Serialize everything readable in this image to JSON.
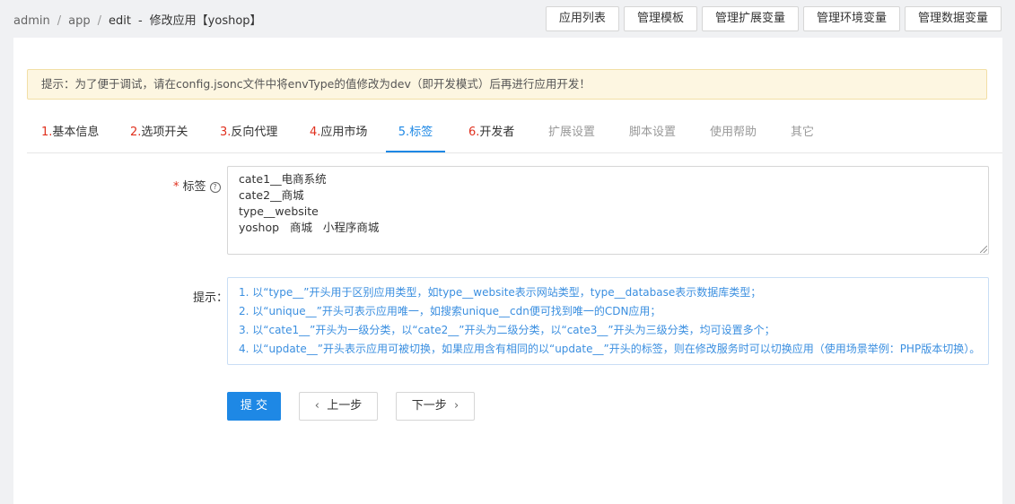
{
  "breadcrumb": {
    "items": [
      "admin",
      "app",
      "edit"
    ],
    "current": "修改应用【yoshop】",
    "dash": "-"
  },
  "top_buttons": [
    "应用列表",
    "管理模板",
    "管理扩展变量",
    "管理环境变量",
    "管理数据变量"
  ],
  "notice": "提示：为了便于调试，请在config.jsonc文件中将envType的值修改为dev（即开发模式）后再进行应用开发！",
  "tabs": [
    {
      "num": "1.",
      "label": "基本信息"
    },
    {
      "num": "2.",
      "label": "选项开关"
    },
    {
      "num": "3.",
      "label": "反向代理"
    },
    {
      "num": "4.",
      "label": "应用市场"
    },
    {
      "num": "5.",
      "label": "标签"
    },
    {
      "num": "6.",
      "label": "开发者"
    },
    {
      "num": "",
      "label": "扩展设置"
    },
    {
      "num": "",
      "label": "脚本设置"
    },
    {
      "num": "",
      "label": "使用帮助"
    },
    {
      "num": "",
      "label": "其它"
    }
  ],
  "active_tab": 4,
  "form": {
    "tags_label": "标签",
    "tags_required_mark": "*",
    "tags_lines": [
      "cate1__电商系统",
      "cate2__商城",
      "type__website",
      "yoshop   商城   小程序商城"
    ],
    "hint_label": "提示：",
    "hint_lines": [
      "1. 以“type__”开头用于区别应用类型，如type__website表示网站类型，type__database表示数据库类型；",
      "2. 以“unique__”开头可表示应用唯一，如搜索unique__cdn便可找到唯一的CDN应用；",
      "3. 以“cate1__”开头为一级分类，以“cate2__”开头为二级分类，以“cate3__”开头为三级分类，均可设置多个；",
      "4. 以“update__”开头表示应用可被切换，如果应用含有相同的以“update__”开头的标签，则在修改服务时可以切换应用（使用场景举例：PHP版本切换）。"
    ]
  },
  "buttons": {
    "submit": "提 交",
    "prev": "上一步",
    "next": "下一步"
  },
  "colors": {
    "primary": "#1e88e5",
    "danger": "#e0301e",
    "notice_bg": "#fdf6e1",
    "hint_text": "#3b8fe0"
  }
}
